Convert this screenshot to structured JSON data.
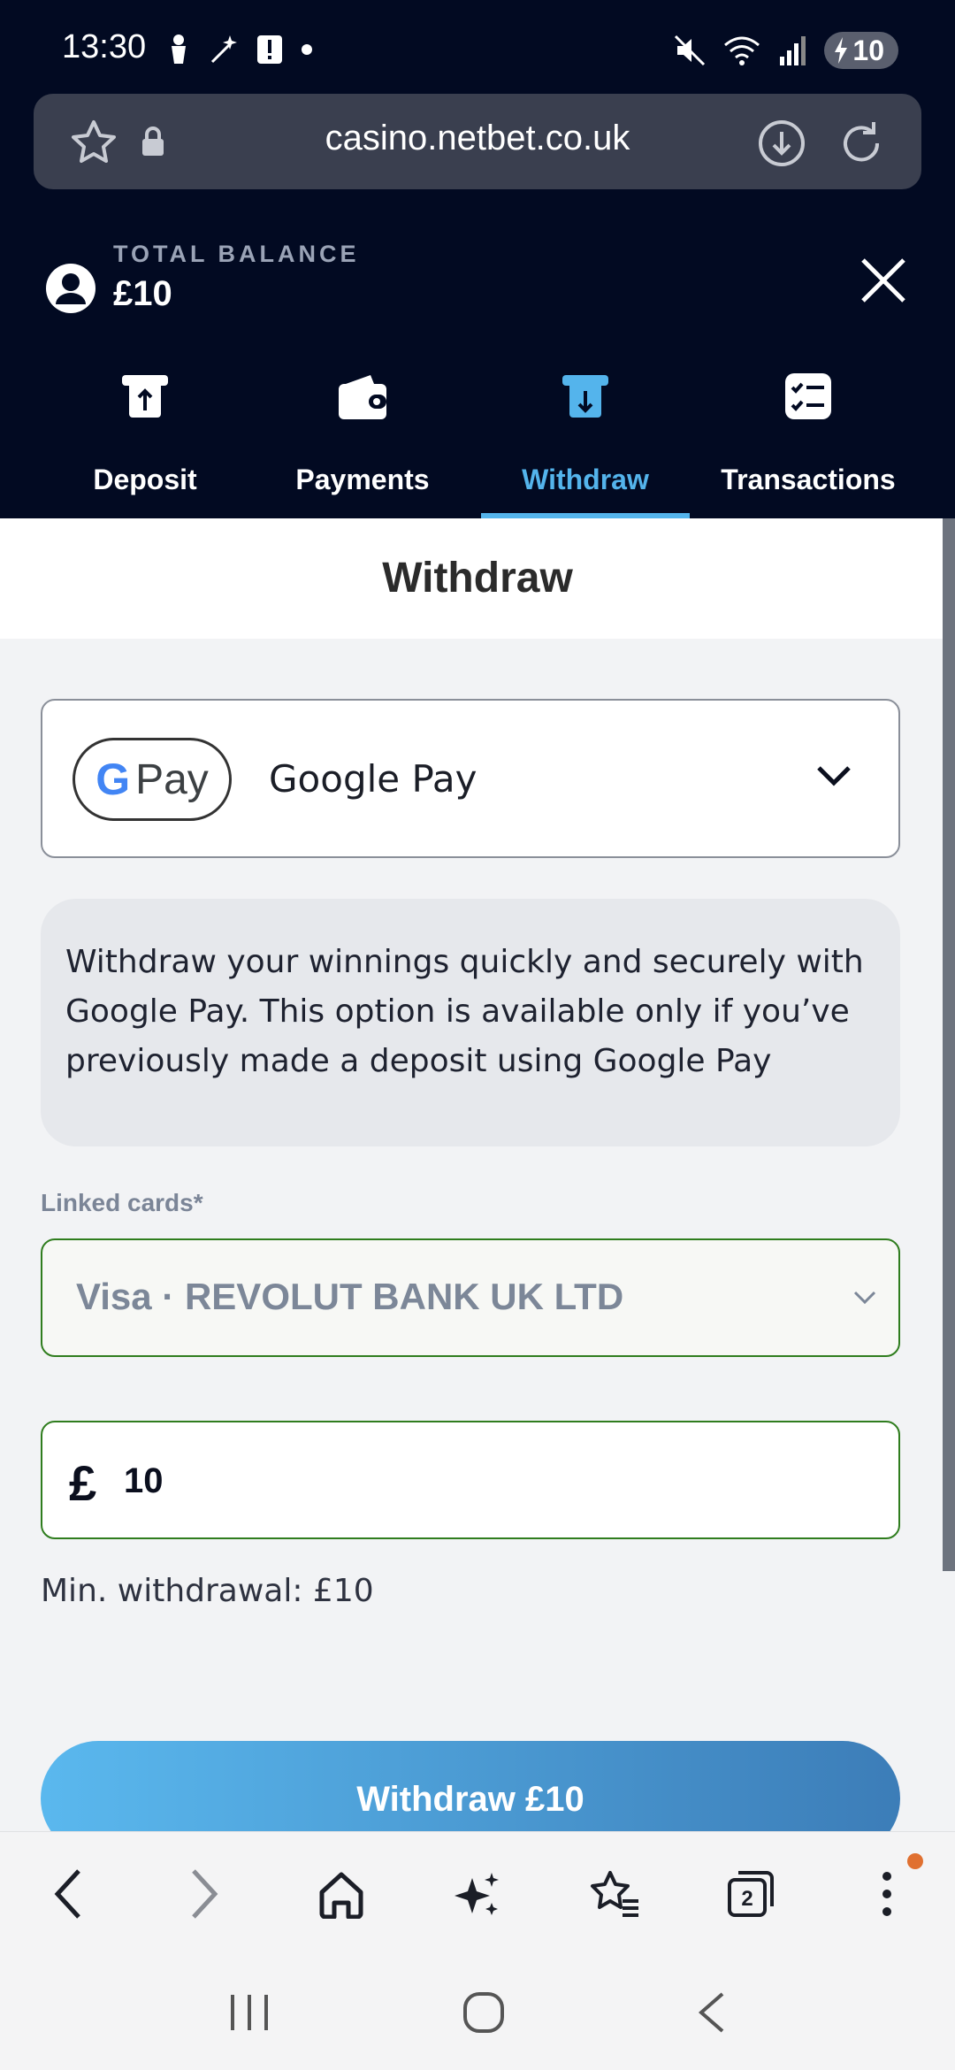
{
  "status_bar": {
    "time": "13:30",
    "battery": "10"
  },
  "browser": {
    "url": "casino.netbet.co.uk"
  },
  "header": {
    "balance_label": "TOTAL BALANCE",
    "balance_value": "£10"
  },
  "tabs": [
    {
      "label": "Deposit",
      "icon": "deposit-icon",
      "active": false
    },
    {
      "label": "Payments",
      "icon": "wallet-icon",
      "active": false
    },
    {
      "label": "Withdraw",
      "icon": "withdraw-icon",
      "active": true
    },
    {
      "label": "Transactions",
      "icon": "transactions-icon",
      "active": false
    }
  ],
  "page": {
    "title": "Withdraw"
  },
  "method": {
    "logo_g": "G",
    "logo_pay": "Pay",
    "name": "Google Pay"
  },
  "info": {
    "text": "Withdraw your winnings quickly and securely with Google Pay. This option is available only if you’ve previously made a deposit using Google Pay"
  },
  "linked_cards": {
    "label": "Linked cards*",
    "selected": "Visa · REVOLUT BANK UK LTD"
  },
  "amount": {
    "currency": "£",
    "value": "10"
  },
  "min_withdrawal": "Min. withdrawal: £10",
  "withdraw_button": "Withdraw £10",
  "colors": {
    "header_bg": "#020a22",
    "accent": "#54b4ec",
    "field_border": "#2f7d1e",
    "button_start": "#5ab8ee",
    "button_end": "#3c7db8"
  }
}
